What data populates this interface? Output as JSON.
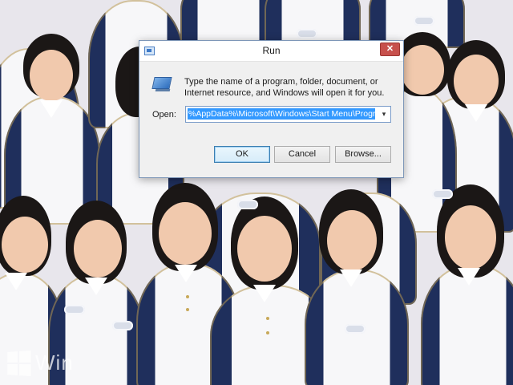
{
  "desktop": {
    "watermark_text": "Win"
  },
  "dialog": {
    "title": "Run",
    "close_glyph": "✕",
    "app_icon": "run-dialog-icon",
    "description": "Type the name of a program, folder, document, or Internet resource, and Windows will open it for you.",
    "open_label": "Open:",
    "open_value": "%AppData%\\Microsoft\\Windows\\Start Menu\\Programs",
    "dropdown_glyph": "▾",
    "buttons": {
      "ok": "OK",
      "cancel": "Cancel",
      "browse": "Browse..."
    }
  },
  "colors": {
    "accent": "#3399ff",
    "close": "#c7504c",
    "uniform_navy": "#1f2f5c",
    "uniform_white": "#f7f7f9"
  }
}
